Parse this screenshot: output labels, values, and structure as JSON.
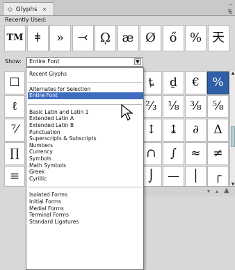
{
  "tab": {
    "label": "Glyphs",
    "close": "×",
    "diamond": "◇"
  },
  "window": {
    "minimize": "–",
    "close": "×",
    "menu": "≡"
  },
  "recent": {
    "label": "Recently Used:",
    "glyphs": [
      "TM",
      "ǂ",
      "»",
      "⤙",
      "ῼ",
      "æ",
      "Ø",
      "ő",
      "%",
      "天"
    ]
  },
  "show": {
    "label": "Show:",
    "selected": "Entire Font"
  },
  "grid": {
    "glyphs": [
      "☐",
      "ȶ",
      "ḏ",
      "€",
      "%",
      "ℓ",
      "⅔",
      "⅛",
      "⅜",
      "⅝",
      "⁷⁄",
      "↕",
      "↨",
      "∂",
      "Δ",
      "∏",
      "∩",
      "∫",
      "≈",
      "≠",
      "≡",
      "⌡",
      "—",
      "│",
      "┌"
    ],
    "selected_index": 4
  },
  "dropdown": {
    "items_group1": [
      "Recent Glyphs"
    ],
    "items_group2": [
      "Alternates for Selection",
      "Entire Font"
    ],
    "items_group3": [
      "Basic Latin and Latin 1",
      "Extended Latin A",
      "Extended Latin B",
      "Punctuation",
      "Superscripts & Subscripts",
      "Numbers",
      "Currency",
      "Symbols",
      "Math Symbols",
      "Greek",
      "Cyrillic"
    ],
    "items_group4": [
      "Isolated Forms",
      "Initial Forms",
      "Medial Forms",
      "Terminal Forms",
      "Standard Ligatures"
    ],
    "highlighted": "Entire Font"
  },
  "colors": {
    "highlight": "#3d6cc0",
    "selected_cell": "#2f5fa8"
  }
}
